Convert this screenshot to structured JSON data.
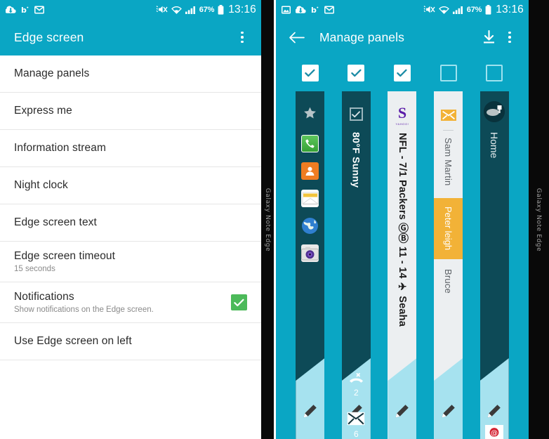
{
  "device": {
    "edge_label": "Galaxy Note Edge"
  },
  "statusbar": {
    "icons_left_a": [
      "photo-icon",
      "cloud-icon",
      "bbm-icon",
      "gmail-icon"
    ],
    "icons_left_b": [
      "cloud-icon",
      "bbm-icon",
      "gmail-icon"
    ],
    "mute_icon": "mute-icon",
    "wifi_icon": "wifi-icon",
    "signal_icon": "signal-icon",
    "battery_pct": "67%",
    "battery_icon": "battery-icon",
    "time": "13:16"
  },
  "left_screen": {
    "title": "Edge screen",
    "overflow_icon": "overflow-menu-icon",
    "items": [
      {
        "title": "Manage panels",
        "sub": "",
        "checkbox": null
      },
      {
        "title": "Express me",
        "sub": "",
        "checkbox": null
      },
      {
        "title": "Information stream",
        "sub": "",
        "checkbox": null
      },
      {
        "title": "Night clock",
        "sub": "",
        "checkbox": null
      },
      {
        "title": "Edge screen text",
        "sub": "",
        "checkbox": null
      },
      {
        "title": "Edge screen timeout",
        "sub": "15 seconds",
        "checkbox": null
      },
      {
        "title": "Notifications",
        "sub": "Show notifications on the Edge screen.",
        "checkbox": true
      },
      {
        "title": "Use Edge screen on left",
        "sub": "",
        "checkbox": null
      }
    ],
    "checkbox_color": "#4cba5a"
  },
  "right_screen": {
    "back_icon": "back-arrow-icon",
    "title": "Manage panels",
    "download_icon": "download-icon",
    "overflow_icon": "overflow-menu-icon",
    "accent_color": "#0aa6c4",
    "panels": [
      {
        "name": "favourites-panel",
        "checked": true,
        "theme": "dark",
        "header_icon": "star-icon",
        "apps": [
          "phone-icon",
          "contacts-icon",
          "email-icon",
          "browser-icon",
          "camera-icon"
        ],
        "edit_icon": "pencil-icon"
      },
      {
        "name": "quick-tools-panel",
        "checked": true,
        "theme": "dark",
        "header_icon": "checkbox-task-icon",
        "weather": "80°F Sunny",
        "missed_call_icon": "missed-call-icon",
        "missed_call_count": "2",
        "unread_mail_icon": "unread-mail-icon",
        "unread_mail_count": "6",
        "edit_icon": "pencil-icon"
      },
      {
        "name": "yahoo-sports-panel",
        "checked": true,
        "theme": "light",
        "logo_text": "S",
        "logo_sub": "YAHOO!",
        "ticker": "NFL - 7/1  Packers ⒼⒷ 11 - 14 ✈ Seaha",
        "edit_icon": "pencil-icon"
      },
      {
        "name": "email-panel",
        "checked": false,
        "theme": "light",
        "header_icon": "mail-icon",
        "senders": [
          "Sam Martin",
          "Peter leigh",
          "Bruce"
        ],
        "highlight_index": 1,
        "highlight_color": "#f2b237",
        "edit_icon": "pencil-icon"
      },
      {
        "name": "home-panel",
        "checked": false,
        "theme": "dark",
        "header_icon": "smart-home-icon",
        "label": "Home",
        "footer_icon": "at-mail-icon",
        "edit_icon": "pencil-icon"
      }
    ]
  }
}
